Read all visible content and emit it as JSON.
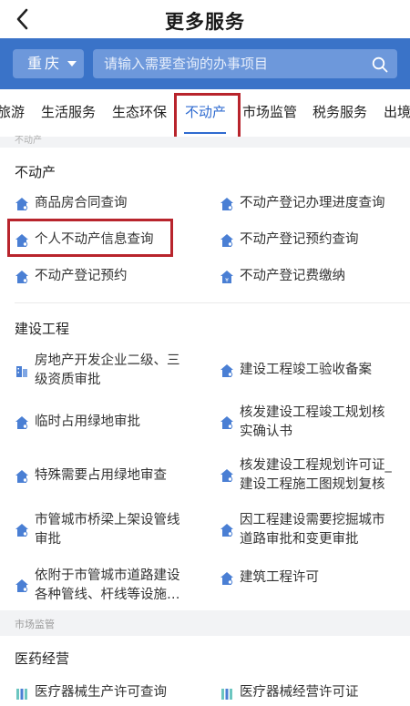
{
  "header": {
    "title": "更多服务"
  },
  "search": {
    "city": "重庆",
    "placeholder": "请输入需要查询的办事项目"
  },
  "tabs": [
    "旅游",
    "生活服务",
    "生态环保",
    "不动产",
    "市场监管",
    "税务服务",
    "出境"
  ],
  "active_tab": "不动产",
  "band_top_label": "不动产",
  "sections": {
    "realestate": {
      "title": "不动产",
      "items": [
        "商品房合同查询",
        "不动产登记办理进度查询",
        "个人不动产信息查询",
        "不动产登记预约查询",
        "不动产登记预约",
        "不动产登记费缴纳"
      ]
    },
    "construction": {
      "title": "建设工程",
      "items": [
        [
          "房地产开发企业二级、三",
          "级资质审批"
        ],
        [
          "建设工程竣工验收备案"
        ],
        [
          "临时占用绿地审批"
        ],
        [
          "核发建设工程竣工规划核",
          "实确认书"
        ],
        [
          "特殊需要占用绿地审查"
        ],
        [
          "核发建设工程规划许可证_",
          "建设工程施工图规划复核"
        ],
        [
          "市管城市桥梁上架设管线",
          "审批"
        ],
        [
          "因工程建设需要挖掘城市",
          "道路审批和变更审批"
        ],
        [
          "依附于市管城市道路建设",
          "各种管线、杆线等设施…"
        ],
        [
          "建筑工程许可"
        ]
      ]
    },
    "market_band_label": "市场监管",
    "medicine": {
      "title": "医药经营",
      "items": [
        "医疗器械生产许可查询",
        "医疗器械经营许可证"
      ]
    }
  },
  "colors": {
    "accent": "#3a73c8",
    "active_tab": "#2f6bd0",
    "highlight": "#b8242c",
    "icon": "#4a7fd4"
  }
}
